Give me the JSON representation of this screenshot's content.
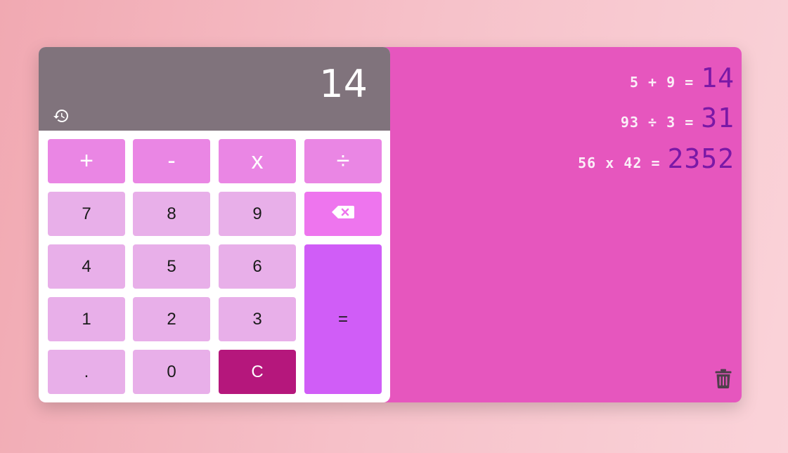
{
  "display": {
    "value": "14"
  },
  "keys": {
    "plus": "+",
    "minus": "-",
    "multiply": "x",
    "divide": "÷",
    "seven": "7",
    "eight": "8",
    "nine": "9",
    "four": "4",
    "five": "5",
    "six": "6",
    "one": "1",
    "two": "2",
    "three": "3",
    "equals": "=",
    "dot": ".",
    "zero": "0",
    "clear": "C"
  },
  "history": [
    {
      "expression": "5 + 9 =",
      "result": "14"
    },
    {
      "expression": "93 ÷ 3 =",
      "result": "31"
    },
    {
      "expression": "56 x 42 =",
      "result": "2352"
    }
  ],
  "icons": {
    "history_toggle": "history-icon",
    "backspace": "backspace-icon",
    "delete_history": "trash-icon"
  },
  "colors": {
    "display_bg": "#80737c",
    "history_panel_bg": "#e656be",
    "operator_key": "#ea86e4",
    "number_key": "#e8afe9",
    "backspace_key": "#ee75ee",
    "equals_key": "#d05df7",
    "clear_key": "#b5177c",
    "history_result": "#7a18a6"
  }
}
